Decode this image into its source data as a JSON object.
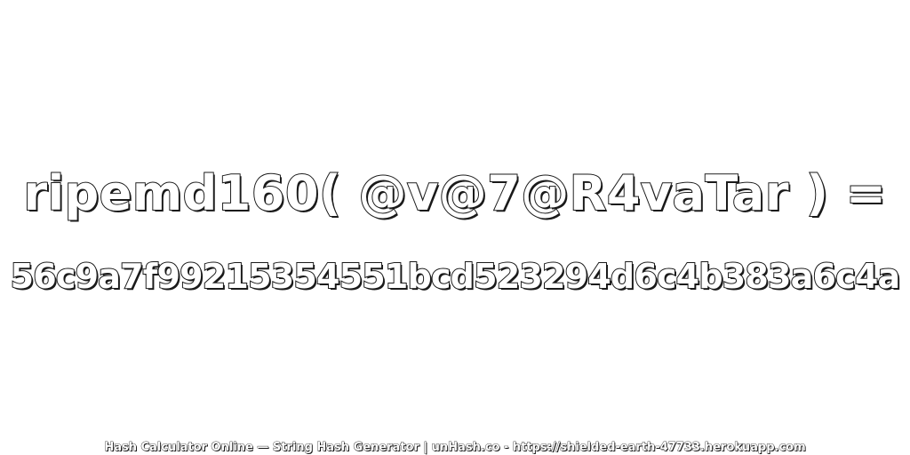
{
  "expression": "ripemd160( @v@7@R4vaTar ) =",
  "hash": "56c9a7f99215354551bcd523294d6c4b383a6c4a",
  "footer": "Hash Calculator Online — String Hash Generator | unHash.co - https://shielded-earth-47733.herokuapp.com",
  "colors": {
    "background": "#ffffff",
    "text_fill": "#ffffff",
    "text_outline": "#1a1a1a"
  }
}
